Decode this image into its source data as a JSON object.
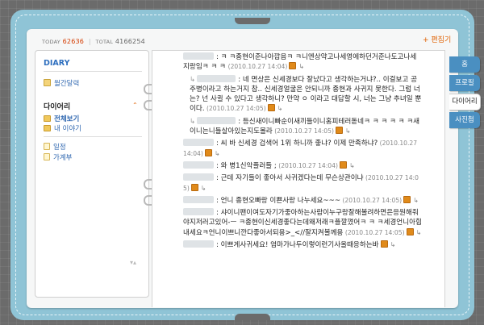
{
  "counter": {
    "today_label": "TODAY",
    "today_value": "62636",
    "total_label": "TOTAL",
    "total_value": "4166254"
  },
  "edit_link": "+ 편집기",
  "sidebar": {
    "title": "DIARY",
    "monthly": "월간달력",
    "section_title": "다이어리",
    "view_all": "전체보기",
    "my_story": "내 이야기",
    "schedule": "일정",
    "household": "가계부"
  },
  "tabs": {
    "home": "홈",
    "profile": "프로필",
    "diary": "다이어리",
    "album": "사진첩"
  },
  "entries": [
    {
      "text": ": ㅋ ㅋ종현이준나아깝음ㅋ ㅋ니엔상약고나세영에하던거준나도고나세지랑임ㅋ ㅋ ㅋ ",
      "date": "(2010.10.27 14:04)",
      "reply": false
    },
    {
      "text": ": 네 면상은 신세경보다 잘났다고 생각하는거냐?.. 이걸보고 공주병이라고 하는거지 참.. 신세경얼굴은 안되니까 종현과 사귀지 못한다. 그럼 너는? 넌 사귈 수 있다고 생각하니? 만약 ㅇ 이라고 대답할 시, 너는 그냥 추녀일 뿐이다.",
      "date": "(2010.10.27 14:05)",
      "reply": true
    },
    {
      "text": ": 등신새이니빠순이새끼들이니홈피테러돋네ㅋ ㅋ ㅋ ㅋ ㅋ ㅋ새이니는니들살아있는지도몰라",
      "date": "(2010.10.27 14:05)",
      "reply": true
    },
    {
      "text": ": 씨 바 신세경 검색어 1위 하니까 좋냐? 이제 만족하냐?",
      "date": "(2010.10.27 14:04)",
      "reply": false
    },
    {
      "text": ": 와 병1신악플러들 ;",
      "date": "(2010.10.27 14:04)",
      "reply": false
    },
    {
      "text": ": 근데 자기들이 좋아서 사귀겠다는데 무슨상관이냐",
      "date": "(2010.10.27 14:05)",
      "reply": false
    },
    {
      "text": ": 언니 종현오빠랑 이쁜사랑 나누세요~~~",
      "date": "(2010.10.27 14:05)",
      "reply": false
    },
    {
      "text": ": 샤이니팬이여도자기가좋아하는사람이누구랑잘해볼려하면은응원해줘야지저러고있어-ㅡ ㅋ종현이신세경좋다는데왜저래ㅋ플깔꼈어ㅋ ㅋ ㅋ세경언니아힘내세요ㅋ언니이쁘니깐다좋아서되용>_<//잘지켜볼께용",
      "date": "(2010.10.27 14:05)",
      "reply": false
    },
    {
      "text": ": 이쁘게사귀세요! 엄마가나두이렇이런기사올때응하는바",
      "date": "",
      "reply": false
    }
  ]
}
